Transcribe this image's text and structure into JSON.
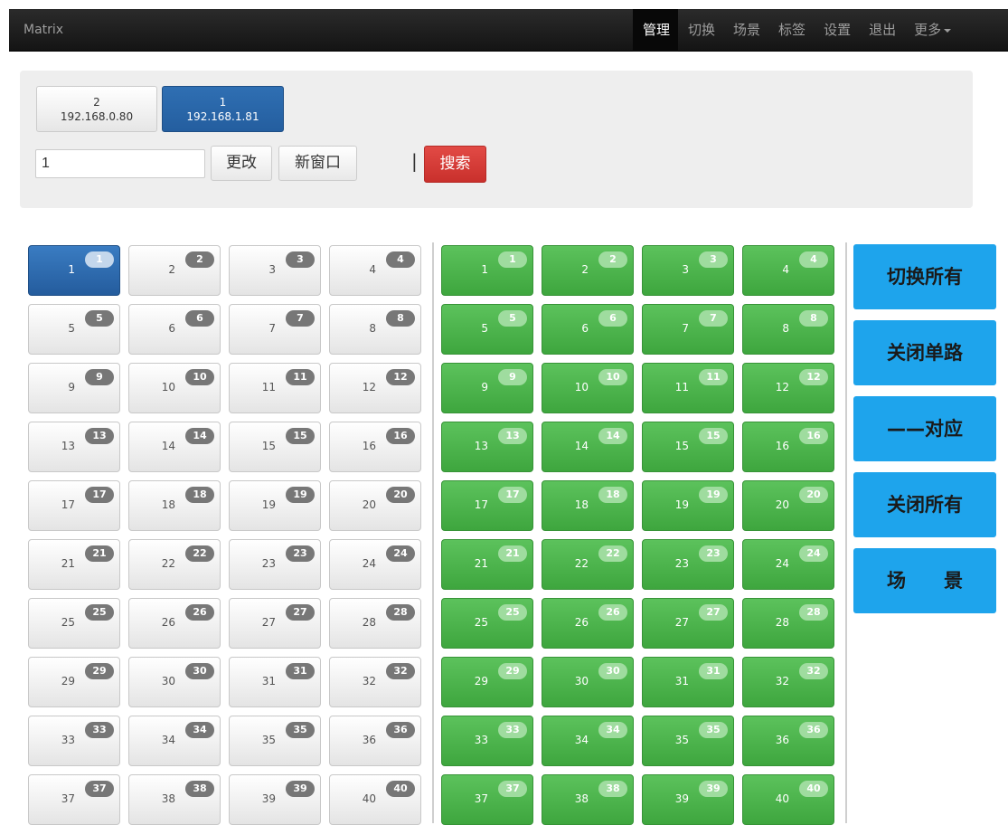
{
  "navbar": {
    "brand": "Matrix",
    "items": [
      {
        "label": "管理",
        "active": true
      },
      {
        "label": "切换",
        "active": false
      },
      {
        "label": "场景",
        "active": false
      },
      {
        "label": "标签",
        "active": false
      },
      {
        "label": "设置",
        "active": false
      },
      {
        "label": "退出",
        "active": false
      },
      {
        "label": "更多",
        "active": false
      }
    ]
  },
  "panel": {
    "hosts": [
      {
        "id": "2",
        "ip": "192.168.0.80",
        "active": false
      },
      {
        "id": "1",
        "ip": "192.168.1.81",
        "active": true
      }
    ],
    "input_value": "1",
    "change_label": "更改",
    "new_window_label": "新窗口",
    "separator": "|",
    "search_label": "搜索"
  },
  "inputs": {
    "selected": 1,
    "cells": [
      1,
      2,
      3,
      4,
      5,
      6,
      7,
      8,
      9,
      10,
      11,
      12,
      13,
      14,
      15,
      16,
      17,
      18,
      19,
      20,
      21,
      22,
      23,
      24,
      25,
      26,
      27,
      28,
      29,
      30,
      31,
      32,
      33,
      34,
      35,
      36,
      37,
      38,
      39,
      40
    ]
  },
  "outputs": {
    "cells": [
      1,
      2,
      3,
      4,
      5,
      6,
      7,
      8,
      9,
      10,
      11,
      12,
      13,
      14,
      15,
      16,
      17,
      18,
      19,
      20,
      21,
      22,
      23,
      24,
      25,
      26,
      27,
      28,
      29,
      30,
      31,
      32,
      33,
      34,
      35,
      36,
      37,
      38,
      39,
      40
    ]
  },
  "actions": {
    "switch_all": "切换所有",
    "close_single": "关闭单路",
    "one_to_one": "——对应",
    "close_all": "关闭所有",
    "scene": "场　　景"
  },
  "colors": {
    "selected_blue": "#245c9d",
    "output_green": "#4cb84c",
    "action_blue": "#1ea4ec",
    "search_red": "#d9534f"
  }
}
